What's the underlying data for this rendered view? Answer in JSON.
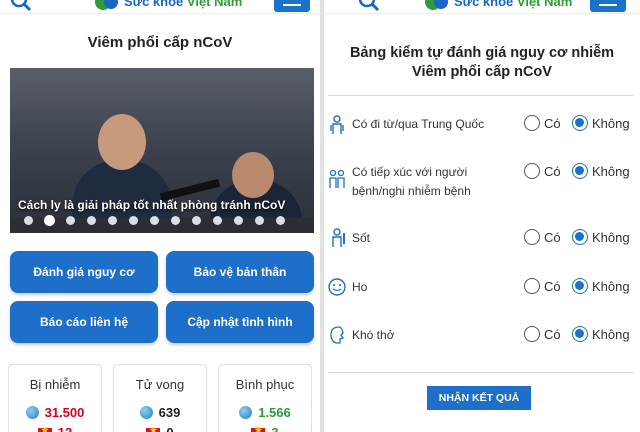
{
  "left": {
    "header": {
      "logo_text_a": "Sức khỏe",
      "logo_text_b": "Việt Nam"
    },
    "title": "Viêm phổi cấp nCoV",
    "hero": {
      "caption": "Cách ly là giải pháp tốt nhất phòng tránh nCoV",
      "slide_count": 13,
      "active_slide": 1
    },
    "buttons": {
      "assess": "Đánh giá nguy cơ",
      "protect": "Bảo vệ bản thân",
      "report": "Báo cáo liên hệ",
      "update": "Cập nhật tình hình"
    },
    "stats": [
      {
        "label": "Bị nhiễm",
        "world": "31.500",
        "world_color": "#d0021b",
        "vn": "12"
      },
      {
        "label": "Tử vong",
        "world": "639",
        "world_color": "#222222",
        "vn": "0"
      },
      {
        "label": "Bình phục",
        "world": "1.566",
        "world_color": "#2e9b3a",
        "vn": "3"
      }
    ]
  },
  "right": {
    "header": {
      "logo_text_a": "Sức khỏe",
      "logo_text_b": "Việt Nam"
    },
    "title": "Bảng kiểm tự đánh giá nguy cơ nhiễm Viêm phổi cấp nCoV",
    "questions": [
      {
        "text": "Có đi từ/qua Trung Quốc",
        "icon": "traveler-icon",
        "selected": "Không"
      },
      {
        "text": "Có tiếp xúc với người bệnh/nghi nhiễm bệnh",
        "icon": "contact-icon",
        "selected": "Không"
      },
      {
        "text": "Sốt",
        "icon": "thermometer-icon",
        "selected": "Không"
      },
      {
        "text": "Ho",
        "icon": "cough-icon",
        "selected": "Không"
      },
      {
        "text": "Khó thở",
        "icon": "breath-icon",
        "selected": "Không"
      }
    ],
    "option_yes": "Có",
    "option_no": "Không",
    "submit": "NHẬN KẾT QUẢ"
  },
  "colors": {
    "primary": "#1d6fc9",
    "brand_blue": "#1a66c2",
    "brand_green": "#2f9b3a"
  }
}
